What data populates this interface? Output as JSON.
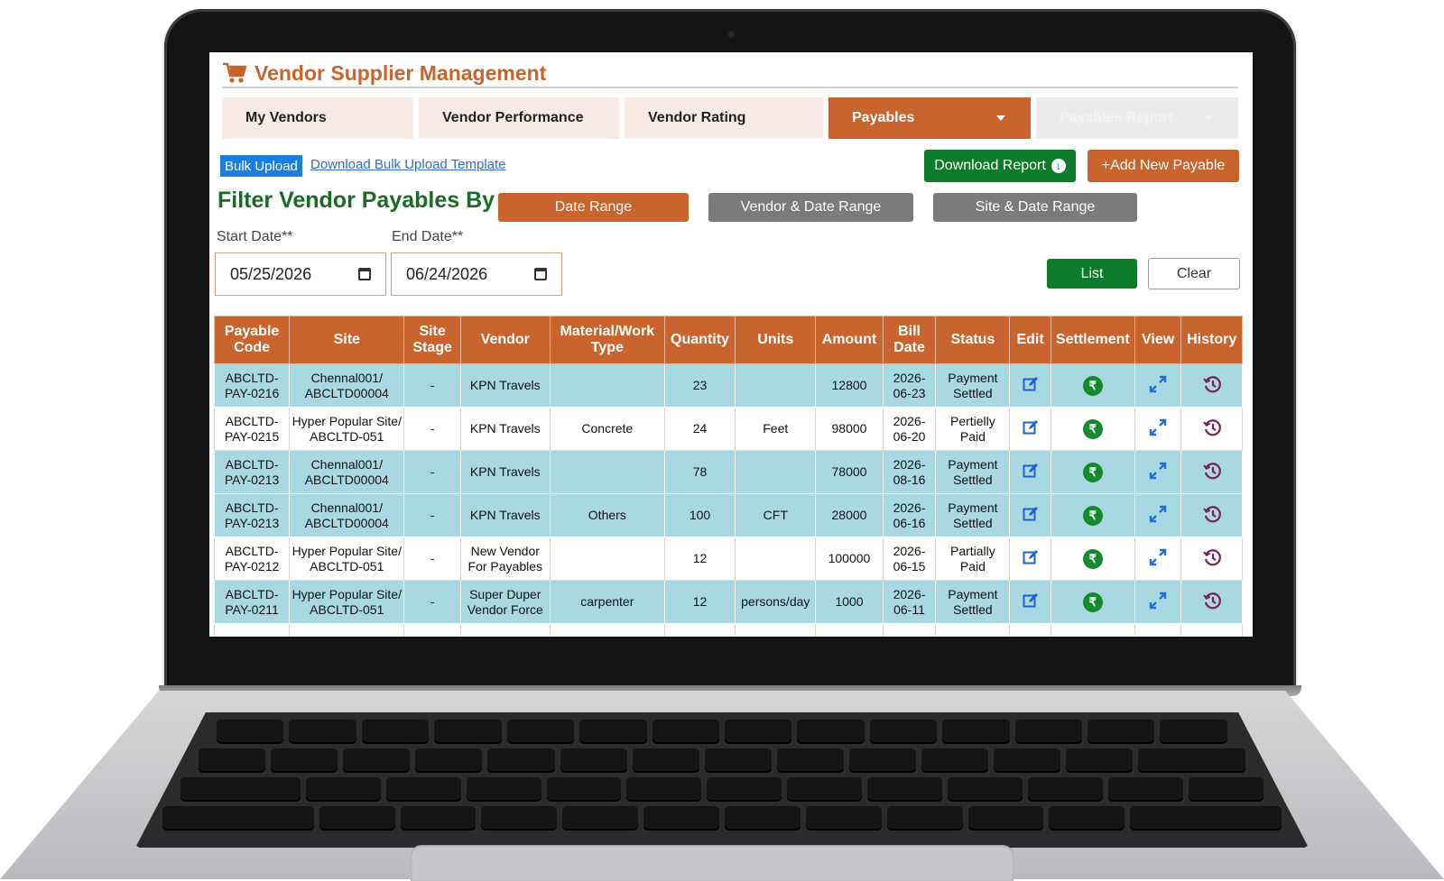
{
  "app": {
    "title": "Vendor Supplier Management"
  },
  "tabs": [
    {
      "label": "My Vendors"
    },
    {
      "label": "Vendor Performance"
    },
    {
      "label": "Vendor Rating"
    },
    {
      "label": "Payables"
    },
    {
      "label": "Payables Report"
    }
  ],
  "actions": {
    "bulk_upload": "Bulk Upload",
    "download_template": "Download Bulk Upload Template",
    "download_report": "Download Report",
    "add_new_payable": "+Add New Payable"
  },
  "filter": {
    "heading": "Filter Vendor Payables By",
    "ranges": [
      "Date Range",
      "Vendor & Date Range",
      "Site & Date Range"
    ],
    "start_label": "Start Date**",
    "end_label": "End Date**",
    "start_value": "05/25/2026",
    "end_value": "06/24/2026",
    "list_label": "List",
    "clear_label": "Clear"
  },
  "table": {
    "columns": [
      [
        "Payable",
        "Code"
      ],
      [
        "Site"
      ],
      [
        "Site",
        "Stage"
      ],
      [
        "Vendor"
      ],
      [
        "Material/Work",
        "Type"
      ],
      [
        "Quantity"
      ],
      [
        "Units"
      ],
      [
        "Amount"
      ],
      [
        "Bill",
        "Date"
      ],
      [
        "Status"
      ],
      [
        "Edit"
      ],
      [
        "Settlement"
      ],
      [
        "View"
      ],
      [
        "History"
      ]
    ],
    "rows": [
      {
        "code": [
          "ABCLTD-",
          "PAY-0216"
        ],
        "site": [
          "Chennal001/",
          "ABCLTD00004"
        ],
        "stage": "-",
        "vendor": [
          "KPN Travels"
        ],
        "material": "",
        "quantity": "23",
        "units": "",
        "amount": "12800",
        "date": [
          "2026-",
          "06-23"
        ],
        "status": [
          "Payment",
          "Settled"
        ]
      },
      {
        "code": [
          "ABCLTD-",
          "PAY-0215"
        ],
        "site": [
          "Hyper Popular Site/",
          "ABCLTD-051"
        ],
        "stage": "-",
        "vendor": [
          "KPN Travels"
        ],
        "material": "Concrete",
        "quantity": "24",
        "units": "Feet",
        "amount": "98000",
        "date": [
          "2026-",
          "06-20"
        ],
        "status": [
          "Pertielly",
          "Paid"
        ]
      },
      {
        "code": [
          "ABCLTD-",
          "PAY-0213"
        ],
        "site": [
          "Chennal001/",
          "ABCLTD00004"
        ],
        "stage": "-",
        "vendor": [
          "KPN Travels"
        ],
        "material": "",
        "quantity": "78",
        "units": "",
        "amount": "78000",
        "date": [
          "2026-",
          "08-16"
        ],
        "status": [
          "Payment",
          "Settled"
        ]
      },
      {
        "code": [
          "ABCLTD-",
          "PAY-0213"
        ],
        "site": [
          "Chennal001/",
          "ABCLTD00004"
        ],
        "stage": "-",
        "vendor": [
          "KPN Travels"
        ],
        "material": "Others",
        "quantity": "100",
        "units": "CFT",
        "amount": "28000",
        "date": [
          "2026-",
          "06-16"
        ],
        "status": [
          "Payment",
          "Settled"
        ]
      },
      {
        "code": [
          "ABCLTD-",
          "PAY-0212"
        ],
        "site": [
          "Hyper Popular Site/",
          "ABCLTD-051"
        ],
        "stage": "-",
        "vendor": [
          "New Vendor",
          "For Payables"
        ],
        "material": "",
        "quantity": "12",
        "units": "",
        "amount": "100000",
        "date": [
          "2026-",
          "06-15"
        ],
        "status": [
          "Partially",
          "Paid"
        ]
      },
      {
        "code": [
          "ABCLTD-",
          "PAY-0211"
        ],
        "site": [
          "Hyper Popular Site/",
          "ABCLTD-051"
        ],
        "stage": "-",
        "vendor": [
          "Super Duper",
          "Vendor Force"
        ],
        "material": "carpenter",
        "quantity": "12",
        "units": "persons/day",
        "amount": "1000",
        "date": [
          "2026-",
          "06-11"
        ],
        "status": [
          "Payment",
          "Settled"
        ]
      }
    ]
  },
  "icons": {
    "cart": "cart-icon",
    "edit": "edit-icon",
    "settlement": "rupee-icon",
    "view": "expand-icon",
    "history": "history-icon",
    "calendar": "calendar-icon",
    "settlement_symbol": "₹",
    "download_symbol": "↓"
  },
  "colors": {
    "accent": "#c9642e",
    "green": "#0d7c2a",
    "teal_row": "#a8d8e2",
    "title": "#c8642c"
  }
}
